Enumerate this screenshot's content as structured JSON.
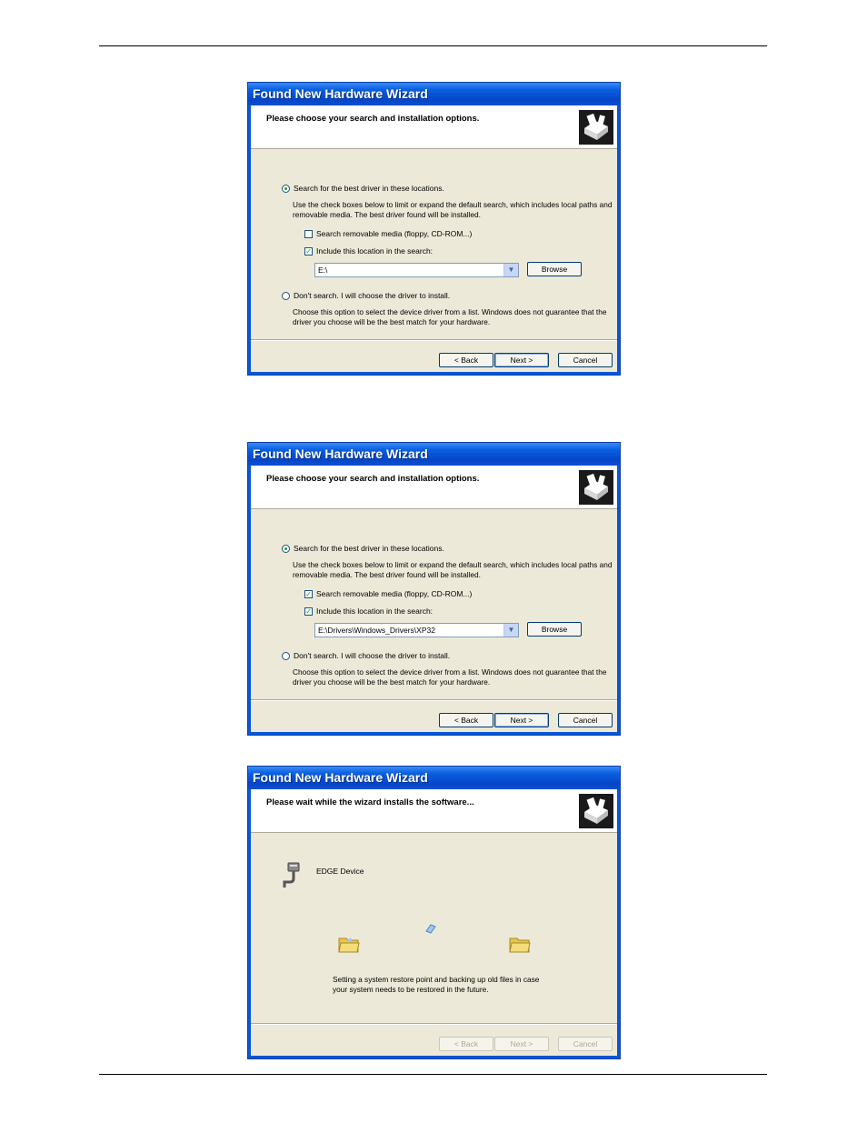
{
  "dialogs": [
    {
      "title": "Found New Hardware Wizard",
      "header": "Please choose your search and installation options.",
      "option_search": "Search for the best driver in these locations.",
      "search_desc": "Use the check boxes below to limit or expand the default search, which includes local paths and removable media. The best driver found will be installed.",
      "chk_removable": "Search removable media (floppy, CD-ROM...)",
      "chk_removable_checked": false,
      "chk_location": "Include this location in the search:",
      "chk_location_checked": true,
      "location_value": "E:\\",
      "browse": "Browse",
      "option_manual": "Don't search. I will choose the driver to install.",
      "manual_desc": "Choose this option to select the device driver from a list.  Windows does not guarantee that the driver you choose will be the best match for your hardware.",
      "back": "< Back",
      "next": "Next >",
      "cancel": "Cancel"
    },
    {
      "title": "Found New Hardware Wizard",
      "header": "Please choose your search and installation options.",
      "option_search": "Search for the best driver in these locations.",
      "search_desc": "Use the check boxes below to limit or expand the default search, which includes local paths and removable media. The best driver found will be installed.",
      "chk_removable": "Search removable media (floppy, CD-ROM...)",
      "chk_removable_checked": true,
      "chk_location": "Include this location in the search:",
      "chk_location_checked": true,
      "location_value": "E:\\Drivers\\Windows_Drivers\\XP32",
      "browse": "Browse",
      "option_manual": "Don't search. I will choose the driver to install.",
      "manual_desc": "Choose this option to select the device driver from a list.  Windows does not guarantee that the driver you choose will be the best match for your hardware.",
      "back": "< Back",
      "next": "Next >",
      "cancel": "Cancel"
    },
    {
      "title": "Found New Hardware Wizard",
      "header": "Please wait while the wizard installs the software...",
      "device_name": "EDGE Device",
      "status": "Setting a system restore point and backing up old files in case your system needs to be restored in the future.",
      "back": "< Back",
      "next": "Next >",
      "cancel": "Cancel"
    }
  ]
}
